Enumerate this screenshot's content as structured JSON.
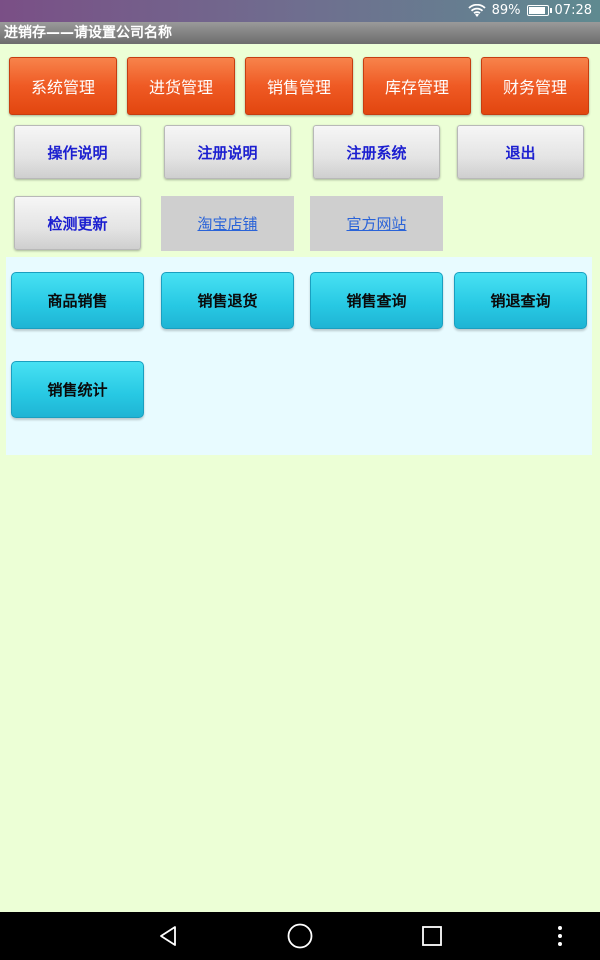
{
  "status": {
    "battery": "89%",
    "time": "07:28",
    "battery_level": 0.89
  },
  "title": "进销存——请设置公司名称",
  "top_menu": [
    "系统管理",
    "进货管理",
    "销售管理",
    "库存管理",
    "财务管理"
  ],
  "row2": [
    "操作说明",
    "注册说明",
    "注册系统",
    "退出"
  ],
  "row3": {
    "update": "检测更新",
    "taobao": "淘宝店铺",
    "website": "官方网站"
  },
  "sales_panel": [
    "商品销售",
    "销售退货",
    "销售查询",
    "销退查询",
    "销售统计"
  ],
  "colors": {
    "orange": "#ef5a24",
    "gray_text": "#1c1fd0",
    "cyan": "#27c8e3",
    "link": "#2a63d8",
    "background": "#ecffd6",
    "panel": "#e8fbff"
  },
  "nav": [
    "back-icon",
    "home-icon",
    "recents-icon",
    "more-icon"
  ]
}
